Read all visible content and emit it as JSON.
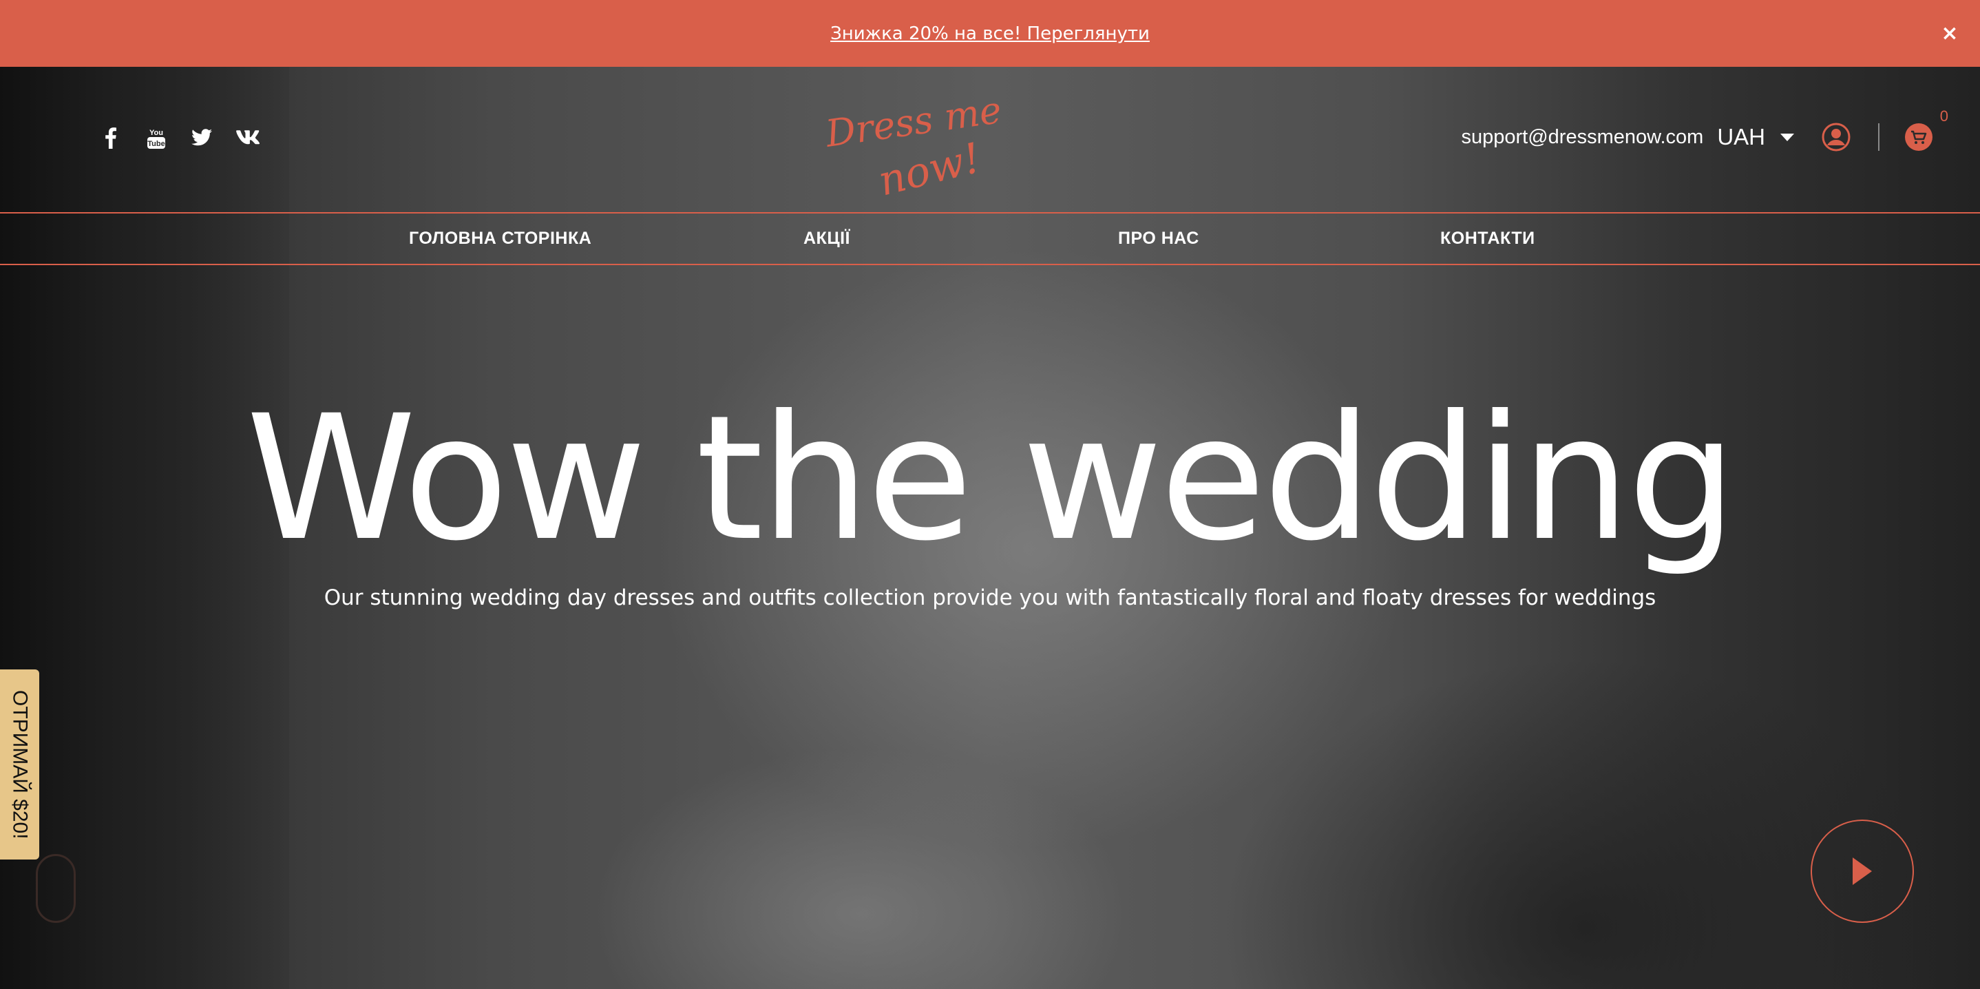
{
  "promo": {
    "text": "Знижка 20% на все! Переглянути",
    "close_glyph": "×"
  },
  "header": {
    "social_icons": [
      "facebook-icon",
      "youtube-icon",
      "twitter-icon",
      "vk-icon"
    ],
    "logo": {
      "line1": "Dress me",
      "line2": "now!"
    },
    "support_email": "support@dressmenow.com",
    "currency": "UAH",
    "cart_count": "0"
  },
  "nav": {
    "items": [
      {
        "label": "ГОЛОВНА СТОРІНКА"
      },
      {
        "label": "АКЦІЇ"
      },
      {
        "label": "ПРО НАС"
      },
      {
        "label": "КОНТАКТИ"
      }
    ]
  },
  "hero": {
    "title": "Wow the wedding",
    "subtitle": "Our stunning wedding day dresses and outfits collection provide you with fantastically floral and floaty dresses for weddings"
  },
  "side_tab": {
    "label": "ОТРИМАЙ $20!"
  },
  "colors": {
    "accent": "#d95f4a",
    "side_tab": "#e7c689",
    "text": "#ffffff"
  }
}
